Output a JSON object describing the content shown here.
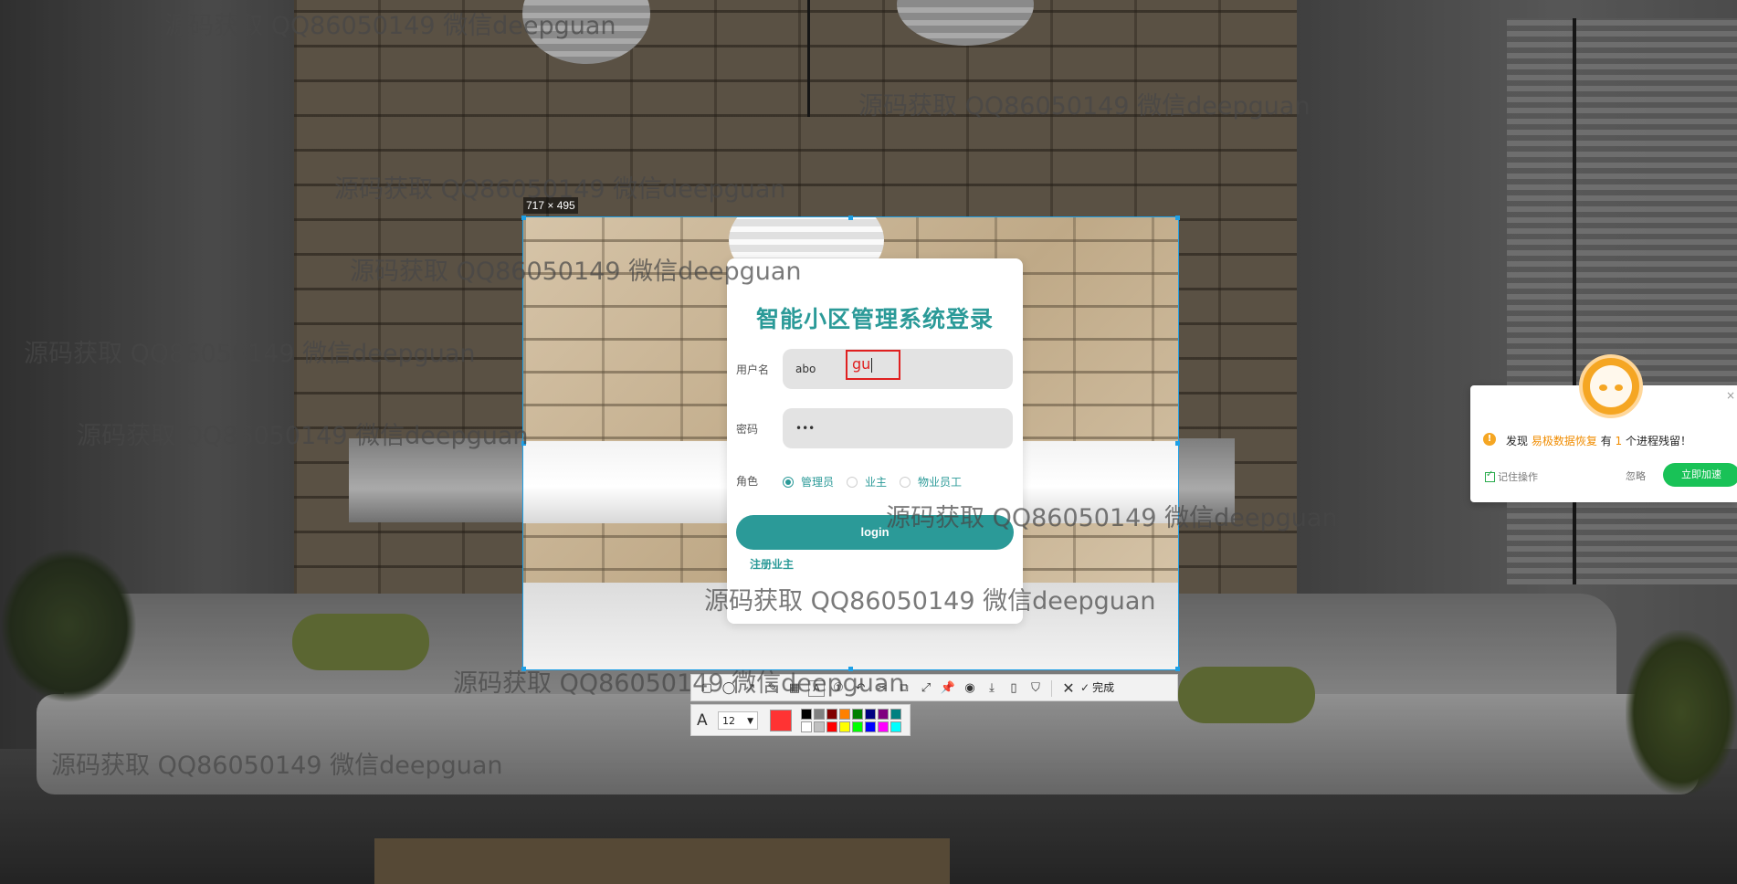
{
  "selection": {
    "size_label": "717 × 495"
  },
  "login": {
    "title": "智能小区管理系统登录",
    "username_label": "用户名",
    "username_value": "abo",
    "annotation_text": "gu",
    "password_label": "密码",
    "password_value": "•••",
    "role_label": "角色",
    "roles": [
      "管理员",
      "业主",
      "物业员工"
    ],
    "selected_role": "管理员",
    "login_button": "login",
    "register_link": "注册业主"
  },
  "toolbar": {
    "tools": [
      "rect",
      "ellipse",
      "arrow",
      "pen",
      "mosaic",
      "text",
      "serial",
      "undo",
      "cut",
      "ocr",
      "scroll",
      "pin",
      "record",
      "save",
      "long",
      "bookmark"
    ],
    "cancel_icon": "close-icon",
    "done_label": "完成",
    "font_size": "12",
    "current_color": "#ff3333",
    "palette_top": [
      "#000000",
      "#808080",
      "#800000",
      "#ff8000",
      "#008000",
      "#000080",
      "#800080",
      "#008080"
    ],
    "palette_bottom": [
      "#ffffff",
      "#c0c0c0",
      "#ff0000",
      "#ffff00",
      "#00ff00",
      "#0000ff",
      "#ff00ff",
      "#00ffff"
    ]
  },
  "popup": {
    "msg_prefix": "发现",
    "app_name": "易极数据恢复",
    "msg_mid": "有",
    "count": "1",
    "msg_suffix": "个进程残留！",
    "remember_label": "记住操作",
    "ignore_label": "忽略",
    "accelerate_button": "立即加速",
    "close": "×"
  },
  "watermark": {
    "text": "源码获取 QQ86050149 微信deepguan"
  },
  "colors": {
    "accent": "#2b9a98",
    "selection": "#1ea0e6",
    "popup_button": "#19c257"
  }
}
